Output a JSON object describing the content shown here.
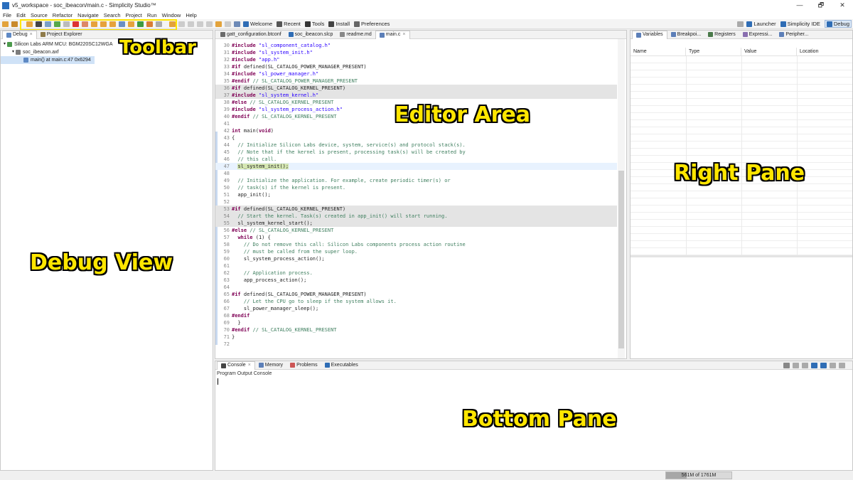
{
  "window": {
    "title": "v5_workspace - soc_ibeacon/main.c - Simplicity Studio™",
    "controls": [
      "—",
      "🗗",
      "✕"
    ]
  },
  "menu": [
    "File",
    "Edit",
    "Source",
    "Refactor",
    "Navigate",
    "Search",
    "Project",
    "Run",
    "Window",
    "Help"
  ],
  "toolbar": {
    "welcome": "Welcome",
    "recent": "Recent",
    "tools": "Tools",
    "install": "Install",
    "preferences": "Preferences",
    "perspectives": [
      "Launcher",
      "Simplicity IDE",
      "Debug"
    ]
  },
  "debug_view": {
    "tabs": [
      "Debug",
      "Project Explorer"
    ],
    "tree": [
      "Silicon Labs ARM MCU: BGM220SC12WGA",
      "soc_ibeacon.axf",
      "main() at main.c:47 0x6294"
    ]
  },
  "editor": {
    "tabs": [
      "gatt_configuration.btconf",
      "soc_ibeacon.slcp",
      "readme.md",
      "main.c"
    ],
    "lines": [
      {
        "n": "30",
        "segs": [
          {
            "t": "#include ",
            "c": "kw"
          },
          {
            "t": "\"sl_component_catalog.h\"",
            "c": "str"
          }
        ]
      },
      {
        "n": "31",
        "segs": [
          {
            "t": "#include ",
            "c": "kw"
          },
          {
            "t": "\"sl_system_init.h\"",
            "c": "str"
          }
        ]
      },
      {
        "n": "32",
        "segs": [
          {
            "t": "#include ",
            "c": "kw"
          },
          {
            "t": "\"app.h\"",
            "c": "str"
          }
        ]
      },
      {
        "n": "33",
        "segs": [
          {
            "t": "#if ",
            "c": "kw"
          },
          {
            "t": "defined(SL_CATALOG_POWER_MANAGER_PRESENT)",
            "c": ""
          }
        ]
      },
      {
        "n": "34",
        "segs": [
          {
            "t": "#include ",
            "c": "kw"
          },
          {
            "t": "\"sl_power_manager.h\"",
            "c": "str"
          }
        ]
      },
      {
        "n": "35",
        "segs": [
          {
            "t": "#endif ",
            "c": "kw"
          },
          {
            "t": "// SL_CATALOG_POWER_MANAGER_PRESENT",
            "c": "cm"
          }
        ]
      },
      {
        "n": "36",
        "bg": "hl",
        "segs": [
          {
            "t": "#if ",
            "c": "kw"
          },
          {
            "t": "defined(SL_CATALOG_KERNEL_PRESENT)",
            "c": ""
          }
        ]
      },
      {
        "n": "37",
        "bg": "hl",
        "segs": [
          {
            "t": "#include ",
            "c": "kw"
          },
          {
            "t": "\"sl_system_kernel.h\"",
            "c": "str"
          }
        ]
      },
      {
        "n": "38",
        "segs": [
          {
            "t": "#else ",
            "c": "kw"
          },
          {
            "t": "// SL_CATALOG_KERNEL_PRESENT",
            "c": "cm"
          }
        ]
      },
      {
        "n": "39",
        "segs": [
          {
            "t": "#include ",
            "c": "kw"
          },
          {
            "t": "\"sl_system_process_action.h\"",
            "c": "str"
          }
        ]
      },
      {
        "n": "40",
        "segs": [
          {
            "t": "#endif ",
            "c": "kw"
          },
          {
            "t": "// SL_CATALOG_KERNEL_PRESENT",
            "c": "cm"
          }
        ]
      },
      {
        "n": "41",
        "segs": []
      },
      {
        "n": "42",
        "segs": [
          {
            "t": "int ",
            "c": "kw"
          },
          {
            "t": "main(",
            "c": ""
          },
          {
            "t": "void",
            "c": "kw"
          },
          {
            "t": ")",
            "c": ""
          }
        ]
      },
      {
        "n": "43",
        "segs": [
          {
            "t": "{",
            "c": ""
          }
        ]
      },
      {
        "n": "44",
        "segs": [
          {
            "t": "  // Initialize Silicon Labs device, system, service(s) and protocol stack(s).",
            "c": "cm"
          }
        ]
      },
      {
        "n": "45",
        "segs": [
          {
            "t": "  // Note that if the kernel is present, processing task(s) will be created by",
            "c": "cm"
          }
        ]
      },
      {
        "n": "46",
        "segs": [
          {
            "t": "  // this call.",
            "c": "cm"
          }
        ]
      },
      {
        "n": "47",
        "bg": "cur",
        "segs": [
          {
            "t": "  ",
            "c": ""
          },
          {
            "t": "sl_system_init();",
            "c": "curcall"
          }
        ]
      },
      {
        "n": "48",
        "segs": []
      },
      {
        "n": "49",
        "segs": [
          {
            "t": "  // Initialize the application. For example, create periodic timer(s) or",
            "c": "cm"
          }
        ]
      },
      {
        "n": "50",
        "segs": [
          {
            "t": "  // task(s) if the kernel is present.",
            "c": "cm"
          }
        ]
      },
      {
        "n": "51",
        "segs": [
          {
            "t": "  app_init();",
            "c": ""
          }
        ]
      },
      {
        "n": "52",
        "segs": []
      },
      {
        "n": "53",
        "bg": "hl",
        "segs": [
          {
            "t": "#if ",
            "c": "kw"
          },
          {
            "t": "defined(SL_CATALOG_KERNEL_PRESENT)",
            "c": ""
          }
        ]
      },
      {
        "n": "54",
        "bg": "hl",
        "segs": [
          {
            "t": "  // Start the kernel. Task(s) created in app_init() will start running.",
            "c": "cm"
          }
        ]
      },
      {
        "n": "55",
        "bg": "hl",
        "segs": [
          {
            "t": "  sl_system_kernel_start();",
            "c": ""
          }
        ]
      },
      {
        "n": "56",
        "segs": [
          {
            "t": "#else ",
            "c": "kw"
          },
          {
            "t": "// SL_CATALOG_KERNEL_PRESENT",
            "c": "cm"
          }
        ]
      },
      {
        "n": "57",
        "segs": [
          {
            "t": "  ",
            "c": ""
          },
          {
            "t": "while ",
            "c": "kw"
          },
          {
            "t": "(1) {",
            "c": ""
          }
        ]
      },
      {
        "n": "58",
        "segs": [
          {
            "t": "    // Do not remove this call: Silicon Labs components process action routine",
            "c": "cm"
          }
        ]
      },
      {
        "n": "59",
        "segs": [
          {
            "t": "    // must be called from the super loop.",
            "c": "cm"
          }
        ]
      },
      {
        "n": "60",
        "segs": [
          {
            "t": "    sl_system_process_action();",
            "c": ""
          }
        ]
      },
      {
        "n": "61",
        "segs": []
      },
      {
        "n": "62",
        "segs": [
          {
            "t": "    // Application process.",
            "c": "cm"
          }
        ]
      },
      {
        "n": "63",
        "segs": [
          {
            "t": "    app_process_action();",
            "c": ""
          }
        ]
      },
      {
        "n": "64",
        "segs": []
      },
      {
        "n": "65",
        "segs": [
          {
            "t": "#if ",
            "c": "kw"
          },
          {
            "t": "defined(SL_CATALOG_POWER_MANAGER_PRESENT)",
            "c": ""
          }
        ]
      },
      {
        "n": "66",
        "segs": [
          {
            "t": "    // Let the CPU go to sleep if the system allows it.",
            "c": "cm"
          }
        ]
      },
      {
        "n": "67",
        "segs": [
          {
            "t": "    sl_power_manager_sleep();",
            "c": ""
          }
        ]
      },
      {
        "n": "68",
        "segs": [
          {
            "t": "#endif",
            "c": "kw"
          }
        ]
      },
      {
        "n": "69",
        "segs": [
          {
            "t": "  }",
            "c": ""
          }
        ]
      },
      {
        "n": "70",
        "segs": [
          {
            "t": "#endif ",
            "c": "kw"
          },
          {
            "t": "// SL_CATALOG_KERNEL_PRESENT",
            "c": "cm"
          }
        ]
      },
      {
        "n": "71",
        "segs": [
          {
            "t": "}",
            "c": ""
          }
        ]
      },
      {
        "n": "72",
        "segs": []
      }
    ]
  },
  "right_pane": {
    "tabs": [
      "Variables",
      "Breakpoi...",
      "Registers",
      "Expressi...",
      "Peripher..."
    ],
    "columns": [
      "Name",
      "Type",
      "Value",
      "Location"
    ]
  },
  "bottom_pane": {
    "tabs": [
      "Console",
      "Memory",
      "Problems",
      "Executables"
    ],
    "console_label": "Program Output Console"
  },
  "status": {
    "heap": "561M of 1761M",
    "heap_used_fraction": 0.32
  },
  "annotations": {
    "toolbar": "Toolbar",
    "editor": "Editor Area",
    "right": "Right Pane",
    "debug": "Debug View",
    "bottom": "Bottom Pane"
  },
  "colors": {
    "annotation": "#ffe600",
    "keyword": "#7f0055",
    "string": "#2a00ff",
    "comment": "#3f7f5f"
  }
}
